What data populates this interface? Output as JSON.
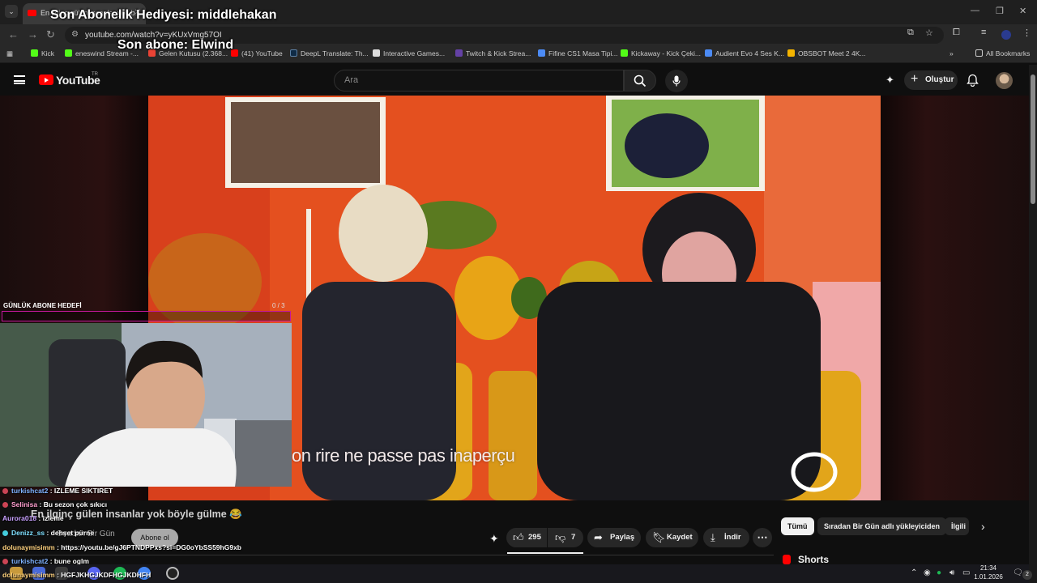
{
  "browser": {
    "tab_title": "En ilginç gülen insanlar yok b...",
    "url": "youtube.com/watch?v=yKUxVmg57OI",
    "bookmarks": [
      {
        "label": "Kick",
        "color": "#53fc18"
      },
      {
        "label": "eneswind Stream -...",
        "color": "#53fc18"
      },
      {
        "label": "Gelen Kutusu (2.368...",
        "color": "#ea4335"
      },
      {
        "label": "(41) YouTube",
        "color": "#ff0000"
      },
      {
        "label": "DeepL Translate: Th...",
        "color": "#0f2b46"
      },
      {
        "label": "Interactive Games...",
        "color": "#dddddd"
      },
      {
        "label": "Twitch & Kick Strea...",
        "color": "#6441a5"
      },
      {
        "label": "Fifine CS1 Masa Tipi...",
        "color": "#4c8bf5"
      },
      {
        "label": "Kickaway - Kick Çeki...",
        "color": "#53fc18"
      },
      {
        "label": "Audient Evo 4 Ses K...",
        "color": "#4c8bf5"
      },
      {
        "label": "OBSBOT Meet 2 4K...",
        "color": "#f4b400"
      }
    ],
    "all_bookmarks_label": "All Bookmarks"
  },
  "youtube": {
    "logo_text": "YouTube",
    "logo_region": "TR",
    "search_placeholder": "Ara",
    "create_label": "Oluştur"
  },
  "overlay": {
    "last_gift": "Son Abonelik Hediyesi: middlehakan",
    "last_sub": "Son abone: Elwind",
    "goal_label": "GÜNLÜK ABONE HEDEFİ",
    "goal_count": "0 / 3",
    "goal_progress": 0,
    "goal_color": "#c4189a"
  },
  "video": {
    "subtitle": "on rire ne passe pas inaperçu",
    "title": "En ilginç gülen insanlar yok böyle gülme 😂",
    "channel": "Sıradan Bir Gün",
    "subscribe_label": "Abone ol",
    "likes": "295",
    "dislikes": "7",
    "share_label": "Paylaş",
    "save_label": "Kaydet",
    "download_label": "İndir"
  },
  "chat": [
    {
      "user": "turkishcat2",
      "message": ": IZLEME SIKTIRET",
      "user_color": "#7fb2ff"
    },
    {
      "user": "Selinisa",
      "message": ": Bu sezon çok sıkıcı",
      "user_color": "#ff9ecf"
    },
    {
      "user": "Aurora018",
      "message": ": izleme",
      "user_color": "#c8a0ff"
    },
    {
      "user": "Denizz_ss",
      "message": ": dehşet pürne",
      "user_color": "#7fe0ff"
    },
    {
      "user": "dolunaymisimm",
      "message": ": https://youtu.be/gJ6PTNDPPxs?si=DG0oYbSS59hG9xb",
      "user_color": "#ffd27f"
    },
    {
      "user": "turkishcat2",
      "message": ": bune oglm",
      "user_color": "#7fb2ff"
    },
    {
      "user": "dolunaymisimm",
      "message": ": HGFJKHGJKDFHGJKDHFH",
      "user_color": "#ffd27f"
    }
  ],
  "chips": [
    {
      "label": "Tümü",
      "active": true
    },
    {
      "label": "Sıradan Bir Gün adlı yükleyiciden",
      "active": false
    },
    {
      "label": "İlgili",
      "active": false
    }
  ],
  "shorts_label": "Shorts",
  "taskbar": {
    "time": "21:34",
    "date": "1.01.2026",
    "notifications": "2"
  }
}
